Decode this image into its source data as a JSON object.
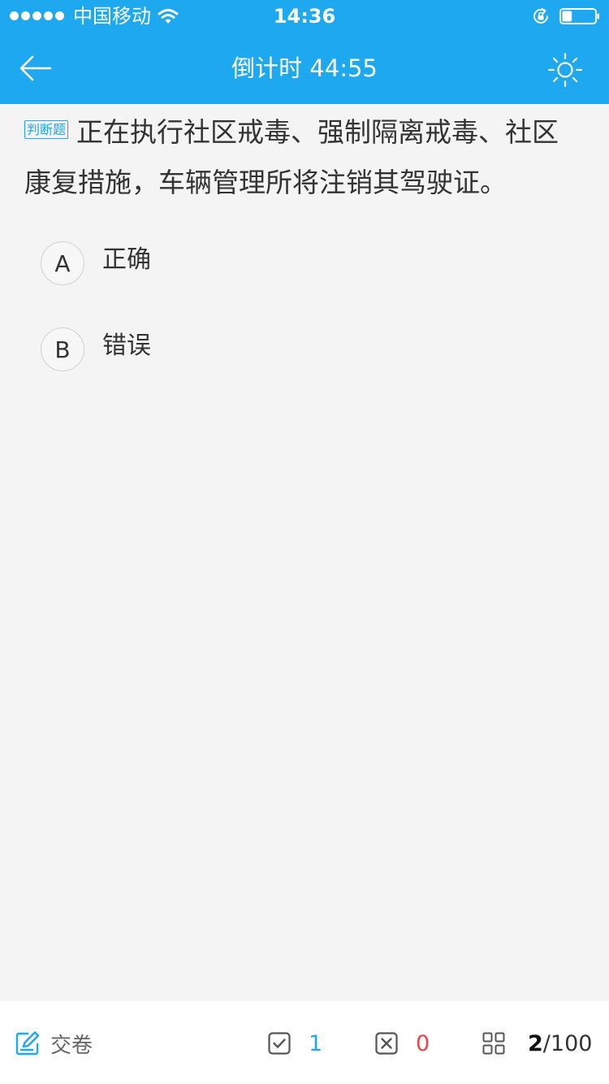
{
  "status_bar": {
    "carrier": "中国移动",
    "time": "14:36",
    "battery_level_percent": 30
  },
  "nav": {
    "title": "倒计时 44:55"
  },
  "question": {
    "type_tag": "判断题",
    "text": "正在执行社区戒毒、强制隔离戒毒、社区康复措施，车辆管理所将注销其驾驶证。"
  },
  "options": [
    {
      "letter": "A",
      "text": "正确"
    },
    {
      "letter": "B",
      "text": "错误"
    }
  ],
  "bottom_bar": {
    "submit_label": "交卷",
    "correct_count": "1",
    "wrong_count": "0",
    "current_question": "2",
    "total_questions": "/100"
  },
  "colors": {
    "accent": "#1da8f0",
    "wrong": "#f2424d",
    "background": "#f4f4f4"
  }
}
